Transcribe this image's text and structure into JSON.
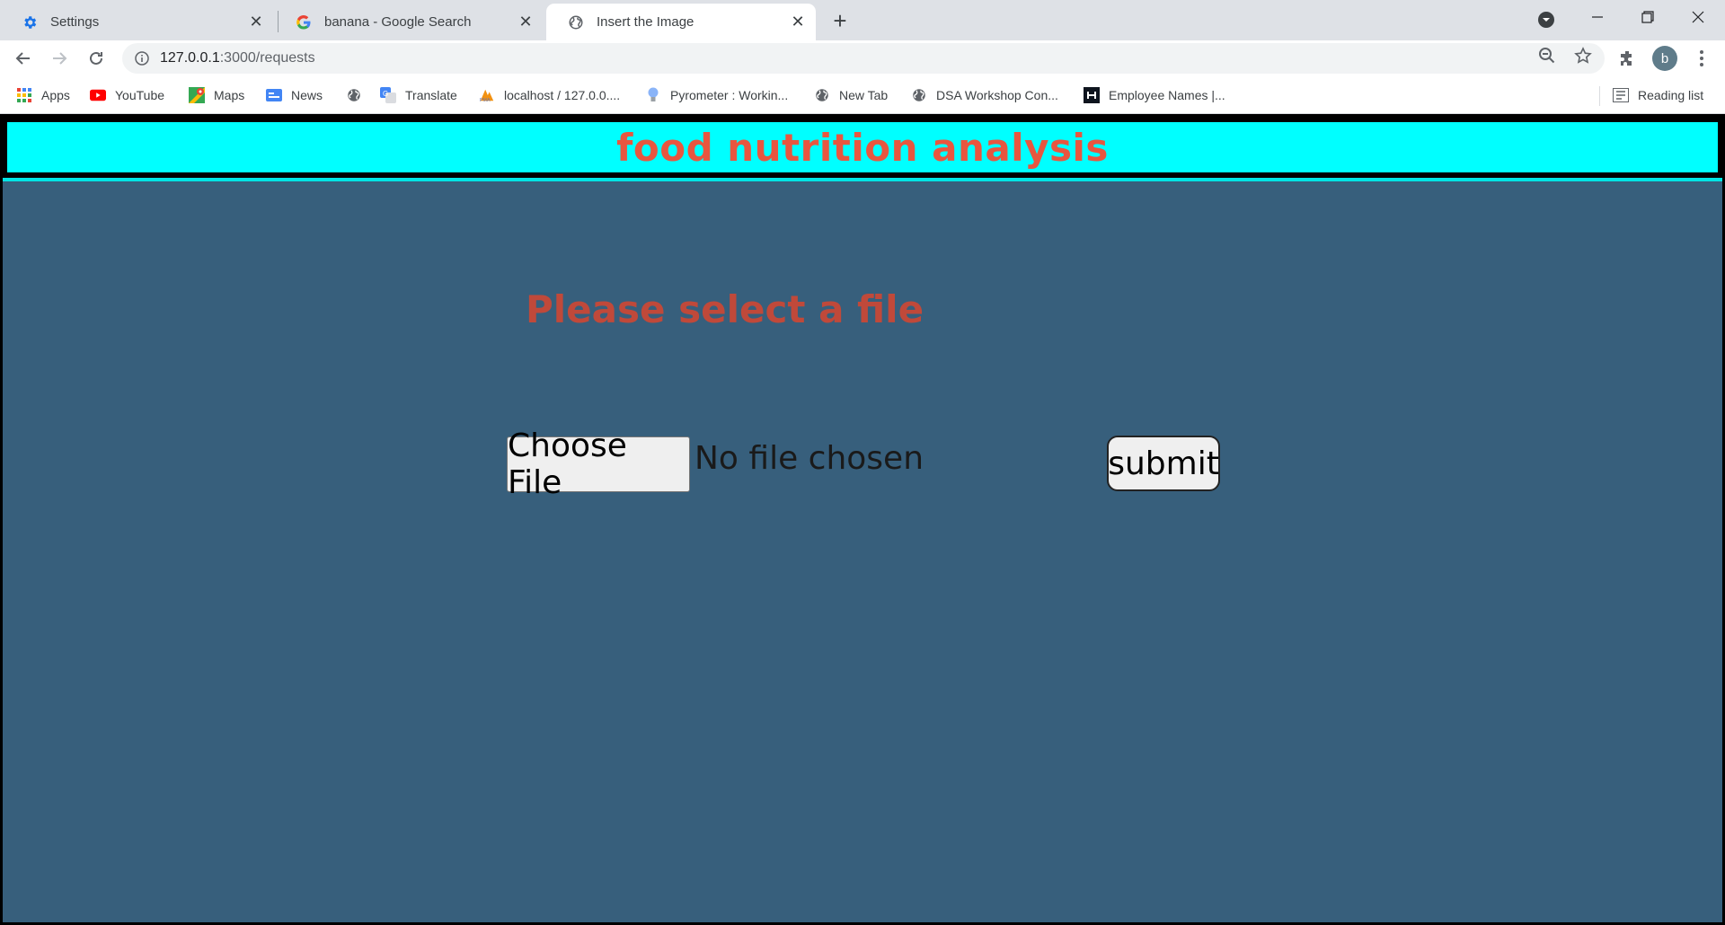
{
  "browser": {
    "tabs": [
      {
        "title": "Settings",
        "icon": "gear-icon"
      },
      {
        "title": "banana - Google Search",
        "icon": "google-icon"
      },
      {
        "title": "Insert the Image",
        "icon": "globe-icon"
      }
    ],
    "url_host": "127.0.0.1",
    "url_path": ":3000/requests",
    "bookmarks": [
      {
        "label": "Apps",
        "icon": "apps-grid-icon"
      },
      {
        "label": "YouTube",
        "icon": "youtube-icon"
      },
      {
        "label": "Maps",
        "icon": "maps-icon"
      },
      {
        "label": "News",
        "icon": "news-icon"
      },
      {
        "label": "",
        "icon": "globe-icon"
      },
      {
        "label": "Translate",
        "icon": "translate-icon"
      },
      {
        "label": "localhost / 127.0.0....",
        "icon": "phpmyadmin-icon"
      },
      {
        "label": "Pyrometer : Workin...",
        "icon": "bulb-icon"
      },
      {
        "label": "New Tab",
        "icon": "globe-icon"
      },
      {
        "label": "DSA Workshop Con...",
        "icon": "globe-icon"
      },
      {
        "label": "Employee Names |...",
        "icon": "hackerrank-icon"
      }
    ],
    "reading_list": "Reading list",
    "avatar_letter": "b"
  },
  "page": {
    "banner_title": "food nutrition analysis",
    "prompt": "Please select a file",
    "choose_file_label": "Choose File",
    "file_status": "No file chosen",
    "submit_label": "submit"
  },
  "colors": {
    "banner_bg": "#00ffff",
    "banner_text": "#e8563f",
    "content_bg": "#375f7c",
    "prompt_text": "#c0493a"
  }
}
